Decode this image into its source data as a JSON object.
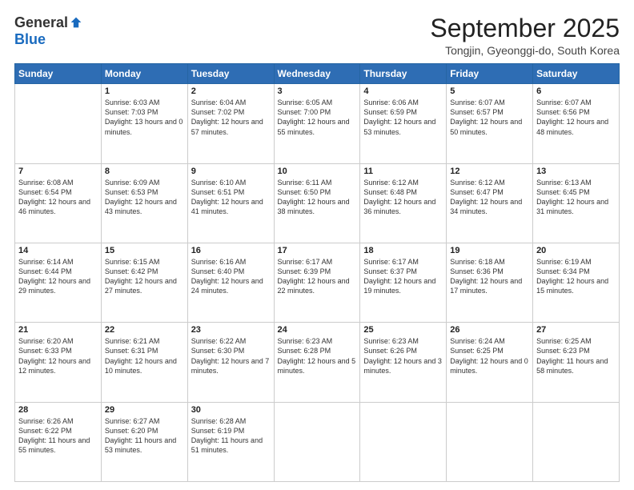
{
  "logo": {
    "general": "General",
    "blue": "Blue"
  },
  "header": {
    "month": "September 2025",
    "location": "Tongjin, Gyeonggi-do, South Korea"
  },
  "weekdays": [
    "Sunday",
    "Monday",
    "Tuesday",
    "Wednesday",
    "Thursday",
    "Friday",
    "Saturday"
  ],
  "weeks": [
    [
      {
        "day": "",
        "sunrise": "",
        "sunset": "",
        "daylight": ""
      },
      {
        "day": "1",
        "sunrise": "Sunrise: 6:03 AM",
        "sunset": "Sunset: 7:03 PM",
        "daylight": "Daylight: 13 hours and 0 minutes."
      },
      {
        "day": "2",
        "sunrise": "Sunrise: 6:04 AM",
        "sunset": "Sunset: 7:02 PM",
        "daylight": "Daylight: 12 hours and 57 minutes."
      },
      {
        "day": "3",
        "sunrise": "Sunrise: 6:05 AM",
        "sunset": "Sunset: 7:00 PM",
        "daylight": "Daylight: 12 hours and 55 minutes."
      },
      {
        "day": "4",
        "sunrise": "Sunrise: 6:06 AM",
        "sunset": "Sunset: 6:59 PM",
        "daylight": "Daylight: 12 hours and 53 minutes."
      },
      {
        "day": "5",
        "sunrise": "Sunrise: 6:07 AM",
        "sunset": "Sunset: 6:57 PM",
        "daylight": "Daylight: 12 hours and 50 minutes."
      },
      {
        "day": "6",
        "sunrise": "Sunrise: 6:07 AM",
        "sunset": "Sunset: 6:56 PM",
        "daylight": "Daylight: 12 hours and 48 minutes."
      }
    ],
    [
      {
        "day": "7",
        "sunrise": "Sunrise: 6:08 AM",
        "sunset": "Sunset: 6:54 PM",
        "daylight": "Daylight: 12 hours and 46 minutes."
      },
      {
        "day": "8",
        "sunrise": "Sunrise: 6:09 AM",
        "sunset": "Sunset: 6:53 PM",
        "daylight": "Daylight: 12 hours and 43 minutes."
      },
      {
        "day": "9",
        "sunrise": "Sunrise: 6:10 AM",
        "sunset": "Sunset: 6:51 PM",
        "daylight": "Daylight: 12 hours and 41 minutes."
      },
      {
        "day": "10",
        "sunrise": "Sunrise: 6:11 AM",
        "sunset": "Sunset: 6:50 PM",
        "daylight": "Daylight: 12 hours and 38 minutes."
      },
      {
        "day": "11",
        "sunrise": "Sunrise: 6:12 AM",
        "sunset": "Sunset: 6:48 PM",
        "daylight": "Daylight: 12 hours and 36 minutes."
      },
      {
        "day": "12",
        "sunrise": "Sunrise: 6:12 AM",
        "sunset": "Sunset: 6:47 PM",
        "daylight": "Daylight: 12 hours and 34 minutes."
      },
      {
        "day": "13",
        "sunrise": "Sunrise: 6:13 AM",
        "sunset": "Sunset: 6:45 PM",
        "daylight": "Daylight: 12 hours and 31 minutes."
      }
    ],
    [
      {
        "day": "14",
        "sunrise": "Sunrise: 6:14 AM",
        "sunset": "Sunset: 6:44 PM",
        "daylight": "Daylight: 12 hours and 29 minutes."
      },
      {
        "day": "15",
        "sunrise": "Sunrise: 6:15 AM",
        "sunset": "Sunset: 6:42 PM",
        "daylight": "Daylight: 12 hours and 27 minutes."
      },
      {
        "day": "16",
        "sunrise": "Sunrise: 6:16 AM",
        "sunset": "Sunset: 6:40 PM",
        "daylight": "Daylight: 12 hours and 24 minutes."
      },
      {
        "day": "17",
        "sunrise": "Sunrise: 6:17 AM",
        "sunset": "Sunset: 6:39 PM",
        "daylight": "Daylight: 12 hours and 22 minutes."
      },
      {
        "day": "18",
        "sunrise": "Sunrise: 6:17 AM",
        "sunset": "Sunset: 6:37 PM",
        "daylight": "Daylight: 12 hours and 19 minutes."
      },
      {
        "day": "19",
        "sunrise": "Sunrise: 6:18 AM",
        "sunset": "Sunset: 6:36 PM",
        "daylight": "Daylight: 12 hours and 17 minutes."
      },
      {
        "day": "20",
        "sunrise": "Sunrise: 6:19 AM",
        "sunset": "Sunset: 6:34 PM",
        "daylight": "Daylight: 12 hours and 15 minutes."
      }
    ],
    [
      {
        "day": "21",
        "sunrise": "Sunrise: 6:20 AM",
        "sunset": "Sunset: 6:33 PM",
        "daylight": "Daylight: 12 hours and 12 minutes."
      },
      {
        "day": "22",
        "sunrise": "Sunrise: 6:21 AM",
        "sunset": "Sunset: 6:31 PM",
        "daylight": "Daylight: 12 hours and 10 minutes."
      },
      {
        "day": "23",
        "sunrise": "Sunrise: 6:22 AM",
        "sunset": "Sunset: 6:30 PM",
        "daylight": "Daylight: 12 hours and 7 minutes."
      },
      {
        "day": "24",
        "sunrise": "Sunrise: 6:23 AM",
        "sunset": "Sunset: 6:28 PM",
        "daylight": "Daylight: 12 hours and 5 minutes."
      },
      {
        "day": "25",
        "sunrise": "Sunrise: 6:23 AM",
        "sunset": "Sunset: 6:26 PM",
        "daylight": "Daylight: 12 hours and 3 minutes."
      },
      {
        "day": "26",
        "sunrise": "Sunrise: 6:24 AM",
        "sunset": "Sunset: 6:25 PM",
        "daylight": "Daylight: 12 hours and 0 minutes."
      },
      {
        "day": "27",
        "sunrise": "Sunrise: 6:25 AM",
        "sunset": "Sunset: 6:23 PM",
        "daylight": "Daylight: 11 hours and 58 minutes."
      }
    ],
    [
      {
        "day": "28",
        "sunrise": "Sunrise: 6:26 AM",
        "sunset": "Sunset: 6:22 PM",
        "daylight": "Daylight: 11 hours and 55 minutes."
      },
      {
        "day": "29",
        "sunrise": "Sunrise: 6:27 AM",
        "sunset": "Sunset: 6:20 PM",
        "daylight": "Daylight: 11 hours and 53 minutes."
      },
      {
        "day": "30",
        "sunrise": "Sunrise: 6:28 AM",
        "sunset": "Sunset: 6:19 PM",
        "daylight": "Daylight: 11 hours and 51 minutes."
      },
      {
        "day": "",
        "sunrise": "",
        "sunset": "",
        "daylight": ""
      },
      {
        "day": "",
        "sunrise": "",
        "sunset": "",
        "daylight": ""
      },
      {
        "day": "",
        "sunrise": "",
        "sunset": "",
        "daylight": ""
      },
      {
        "day": "",
        "sunrise": "",
        "sunset": "",
        "daylight": ""
      }
    ]
  ]
}
